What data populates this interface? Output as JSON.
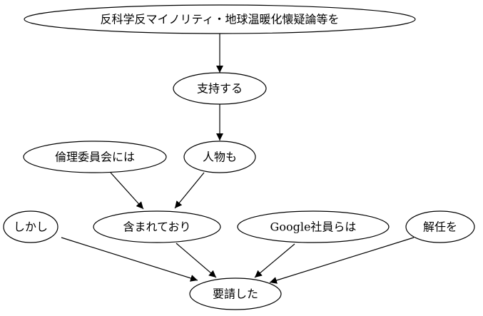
{
  "graph": {
    "nodes": [
      {
        "id": "n1",
        "label": "反科学反マイノリティ・地球温暖化懐疑論等を"
      },
      {
        "id": "n2",
        "label": "支持する"
      },
      {
        "id": "n3",
        "label": "倫理委員会には"
      },
      {
        "id": "n4",
        "label": "人物も"
      },
      {
        "id": "n5",
        "label": "しかし"
      },
      {
        "id": "n6",
        "label": "含まれており"
      },
      {
        "id": "n7",
        "label": "Google社員らは"
      },
      {
        "id": "n8",
        "label": "解任を"
      },
      {
        "id": "n9",
        "label": "要請した"
      }
    ],
    "edges": [
      {
        "from": "n1",
        "to": "n2"
      },
      {
        "from": "n2",
        "to": "n4"
      },
      {
        "from": "n3",
        "to": "n6"
      },
      {
        "from": "n4",
        "to": "n6"
      },
      {
        "from": "n5",
        "to": "n9"
      },
      {
        "from": "n6",
        "to": "n9"
      },
      {
        "from": "n7",
        "to": "n9"
      },
      {
        "from": "n8",
        "to": "n9"
      }
    ]
  }
}
